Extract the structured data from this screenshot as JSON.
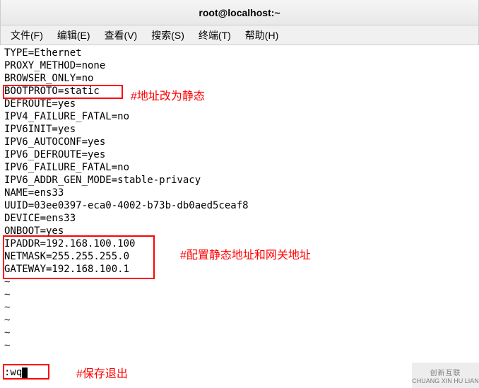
{
  "titlebar": {
    "title": "root@localhost:~"
  },
  "menubar": {
    "items": [
      {
        "label": "文件(F)"
      },
      {
        "label": "编辑(E)"
      },
      {
        "label": "查看(V)"
      },
      {
        "label": "搜索(S)"
      },
      {
        "label": "终端(T)"
      },
      {
        "label": "帮助(H)"
      }
    ]
  },
  "terminal": {
    "lines": [
      "TYPE=Ethernet",
      "PROXY_METHOD=none",
      "BROWSER_ONLY=no",
      "BOOTPROTO=static  ",
      "DEFROUTE=yes",
      "IPV4_FAILURE_FATAL=no",
      "IPV6INIT=yes",
      "IPV6_AUTOCONF=yes",
      "IPV6_DEFROUTE=yes",
      "IPV6_FAILURE_FATAL=no",
      "IPV6_ADDR_GEN_MODE=stable-privacy",
      "NAME=ens33",
      "UUID=03ee0397-eca0-4002-b73b-db0aed5ceaf8",
      "DEVICE=ens33",
      "ONBOOT=yes",
      "IPADDR=192.168.100.100",
      "NETMASK=255.255.255.0",
      "GATEWAY=192.168.100.1"
    ],
    "tildes": [
      "~",
      "~",
      "~",
      "~",
      "~",
      "~"
    ],
    "command": ":wq"
  },
  "annotations": {
    "static_addr": "#地址改为静态",
    "ip_config": "#配置静态地址和网关地址",
    "save_exit": "#保存退出"
  },
  "watermark": {
    "brand": "创新互联",
    "sub": "CHUANG XIN HU LIAN"
  }
}
